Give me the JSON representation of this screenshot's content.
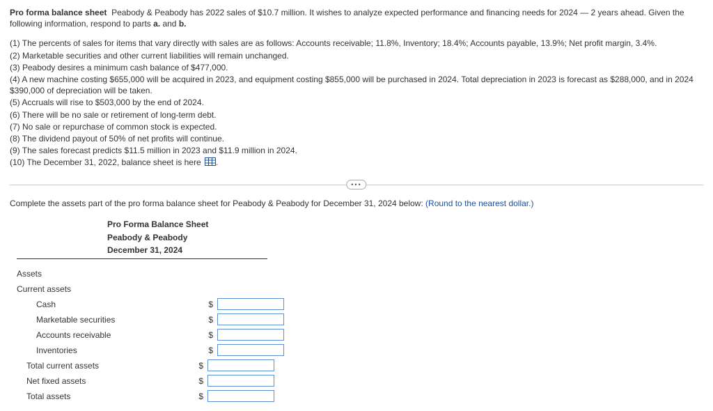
{
  "intro": {
    "title": "Pro forma balance sheet",
    "body_a": "Peabody & Peabody has 2022 sales of $10.7 million. It wishes to analyze expected performance and financing needs for 2024 — 2 years ahead. Given the following information, respond to parts ",
    "body_b": "a.",
    "body_c": " and ",
    "body_d": "b."
  },
  "assumptions": {
    "l1": "(1) The percents of sales for items that vary directly with sales are as follows: Accounts receivable; 11.8%, Inventory; 18.4%; Accounts payable, 13.9%; Net profit margin, 3.4%.",
    "l2": "(2) Marketable securities and other current liabilities will remain unchanged.",
    "l3": "(3) Peabody desires a minimum cash balance of $477,000.",
    "l4": "(4) A new machine costing $655,000 will be acquired in 2023, and equipment costing $855,000 will be purchased in 2024. Total depreciation in 2023 is forecast as $288,000, and in 2024 $390,000 of depreciation will be taken.",
    "l5": "(5) Accruals will rise to $503,000 by the end of 2024.",
    "l6": "(6) There will be no sale or retirement of long-term debt.",
    "l7": "(7) No sale or repurchase of common stock is expected.",
    "l8": "(8) The dividend payout of 50% of net profits will continue.",
    "l9": "(9) The sales forecast predicts $11.5 million in 2023 and $11.9 million in 2024.",
    "l10a": "(10) The December 31, 2022, balance sheet is here ",
    "l10b": "."
  },
  "ellipsis": "•••",
  "instruction": {
    "text": "Complete the assets part of the pro forma balance sheet for Peabody & Peabody for December 31, 2024 below:  ",
    "round": "(Round to the nearest dollar.)"
  },
  "sheet": {
    "header1": "Pro Forma Balance Sheet",
    "header2": "Peabody & Peabody",
    "header3": "December 31, 2024",
    "assets": "Assets",
    "current_assets": "Current assets",
    "rows": {
      "cash": "Cash",
      "mkt": "Marketable securities",
      "ar": "Accounts receivable",
      "inv": "Inventories",
      "tca": "Total current assets",
      "nfa": "Net fixed assets",
      "ta": "Total assets"
    },
    "currency": "$"
  }
}
